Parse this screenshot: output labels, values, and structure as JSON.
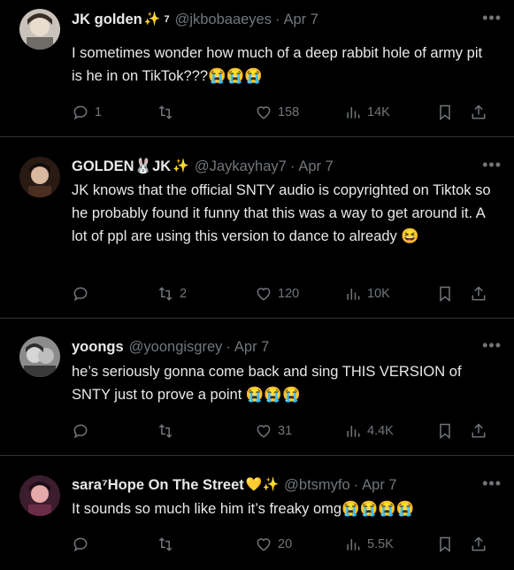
{
  "tweets": [
    {
      "name": "JK golden",
      "name_emoji": "✨",
      "sup": "7",
      "handle": "@jkbobaaeyes",
      "date": "Apr 7",
      "text": "I sometimes wonder how much of a deep rabbit hole of army pit is he in on TikTok???😭😭😭",
      "replies": "1",
      "reposts": "",
      "likes": "158",
      "views": "14K"
    },
    {
      "name": "GOLDEN🐰JK",
      "name_emoji": "✨",
      "handle": "@Jaykayhay7",
      "date": "Apr 7",
      "text": "JK knows that the official SNTY audio is copyrighted on Tiktok so he probably found it funny that this was a way to get around it. A lot of ppl are using this version to dance to already 😆",
      "replies": "",
      "reposts": "2",
      "likes": "120",
      "views": "10K"
    },
    {
      "name": "yoongs",
      "handle": "@yoongisgrey",
      "date": "Apr 7",
      "text": "he’s seriously gonna come back and sing THIS VERSION of SNTY just to prove a point 😭😭😭",
      "replies": "",
      "reposts": "",
      "likes": "31",
      "views": "4.4K"
    },
    {
      "name": "sara⁷Hope On The Street",
      "name_emoji": "💛✨",
      "handle": "@btsmyfo",
      "date": "Apr 7",
      "text": "It sounds so much like him it’s freaky omg😭😭😭😭",
      "replies": "",
      "reposts": "",
      "likes": "20",
      "views": "5.5K"
    }
  ],
  "more_label": "•••",
  "dot": "·",
  "colors": {
    "background": "#000000",
    "text": "#e7e9ea",
    "muted": "#71767b",
    "divider": "#2f3336"
  },
  "icons": [
    "reply-icon",
    "repost-icon",
    "like-icon",
    "views-icon",
    "bookmark-icon",
    "share-icon",
    "more-icon"
  ]
}
